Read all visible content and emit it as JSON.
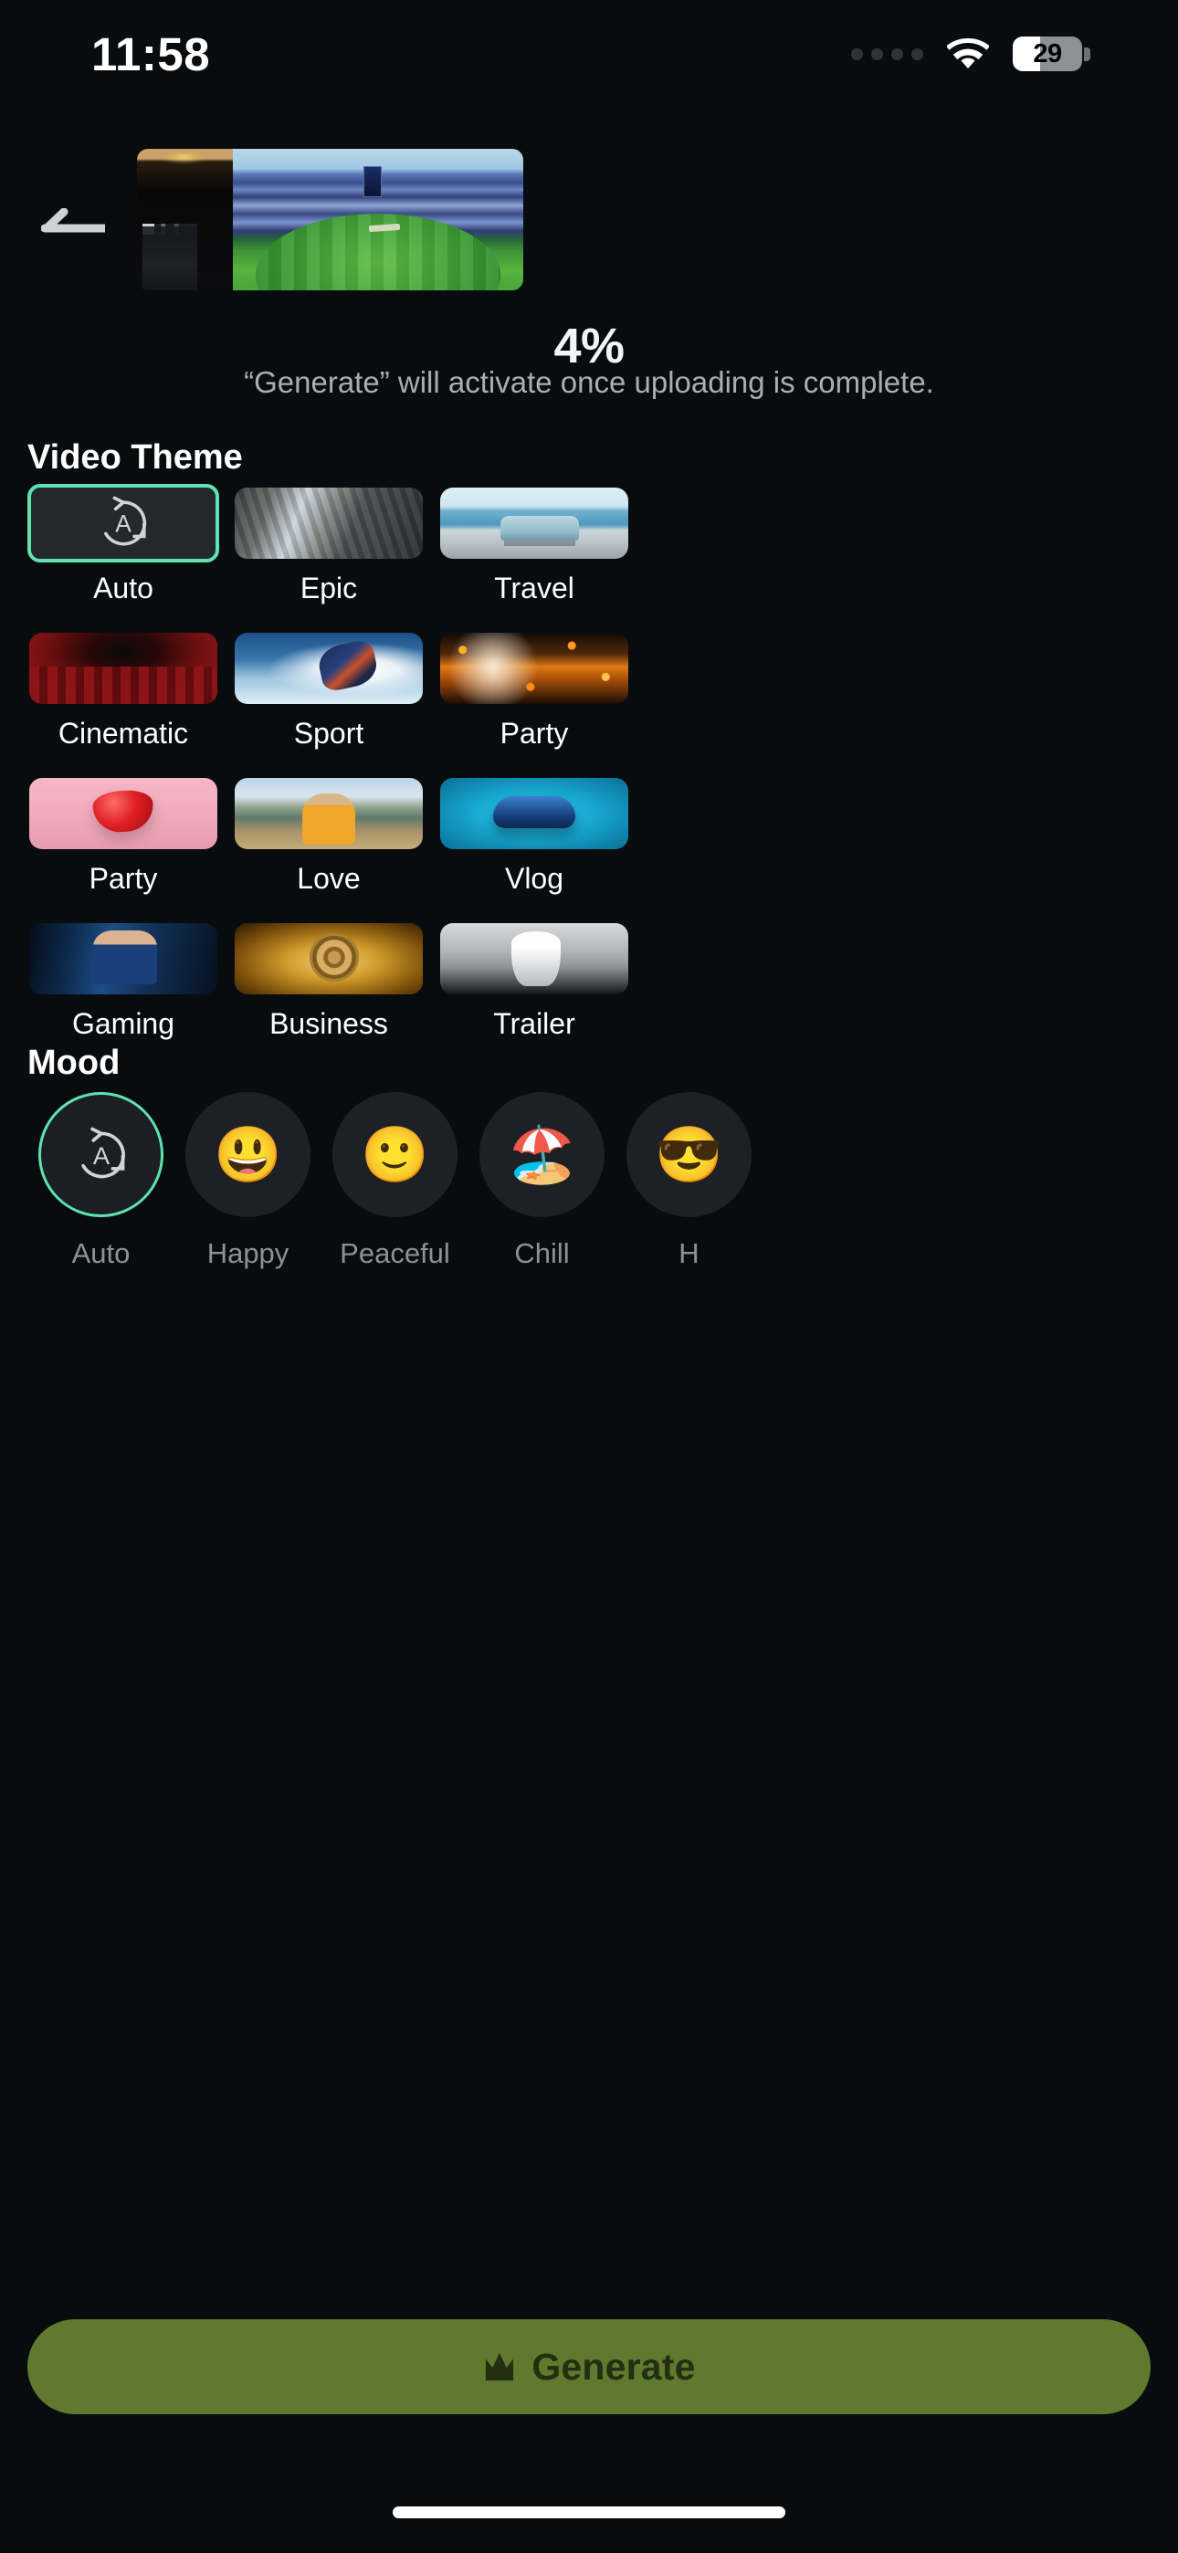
{
  "status_bar": {
    "time": "11:58",
    "battery_level": "29",
    "wifi_icon": "wifi-icon",
    "dots_icon": "activity-dots-icon"
  },
  "nav": {
    "back_icon": "back-arrow-icon"
  },
  "upload": {
    "percent": "4%",
    "note": "“Generate” will activate once uploading is complete.",
    "preview_alt": "cricket-stadium-video-thumbnail"
  },
  "theme_section": {
    "title": "Video Theme",
    "items": [
      {
        "label": "Auto",
        "art": "auto",
        "icon": "auto-mode-icon",
        "selected": true
      },
      {
        "label": "Epic",
        "art": "epic",
        "icon": "",
        "selected": false
      },
      {
        "label": "Travel",
        "art": "travel",
        "icon": "",
        "selected": false
      },
      {
        "label": "Cinematic",
        "art": "cinematic",
        "icon": "",
        "selected": false
      },
      {
        "label": "Sport",
        "art": "sport",
        "icon": "",
        "selected": false
      },
      {
        "label": "Party",
        "art": "party",
        "icon": "",
        "selected": false
      },
      {
        "label": "Party",
        "art": "party2",
        "icon": "",
        "selected": false
      },
      {
        "label": "Love",
        "art": "love",
        "icon": "",
        "selected": false
      },
      {
        "label": "Vlog",
        "art": "vlog",
        "icon": "",
        "selected": false
      },
      {
        "label": "Gaming",
        "art": "gaming",
        "icon": "",
        "selected": false
      },
      {
        "label": "Business",
        "art": "business",
        "icon": "",
        "selected": false
      },
      {
        "label": "Trailer",
        "art": "trailer",
        "icon": "",
        "selected": false
      }
    ]
  },
  "mood_section": {
    "title": "Mood",
    "items": [
      {
        "label": "Auto",
        "emoji": "",
        "icon": "auto-mode-icon",
        "selected": true
      },
      {
        "label": "Happy",
        "emoji": "😃",
        "icon": "grinning-face-icon",
        "selected": false
      },
      {
        "label": "Peaceful",
        "emoji": "🙂",
        "icon": "slightly-smiling-face-icon",
        "selected": false
      },
      {
        "label": "Chill",
        "emoji": "🏖️",
        "icon": "beach-umbrella-icon",
        "selected": false
      },
      {
        "label": "H",
        "emoji": "😎",
        "icon": "smiling-face-sunglasses-icon",
        "selected": false
      }
    ]
  },
  "generate": {
    "label": "Generate",
    "icon": "crown-icon",
    "enabled": false
  },
  "colors": {
    "background": "#090c0e",
    "accent_teal": "#5fe3b0",
    "generate_button": "#5f7a2e",
    "generate_text": "#242e10",
    "tile_surface": "#1d2125",
    "secondary_text": "#8c9196"
  }
}
